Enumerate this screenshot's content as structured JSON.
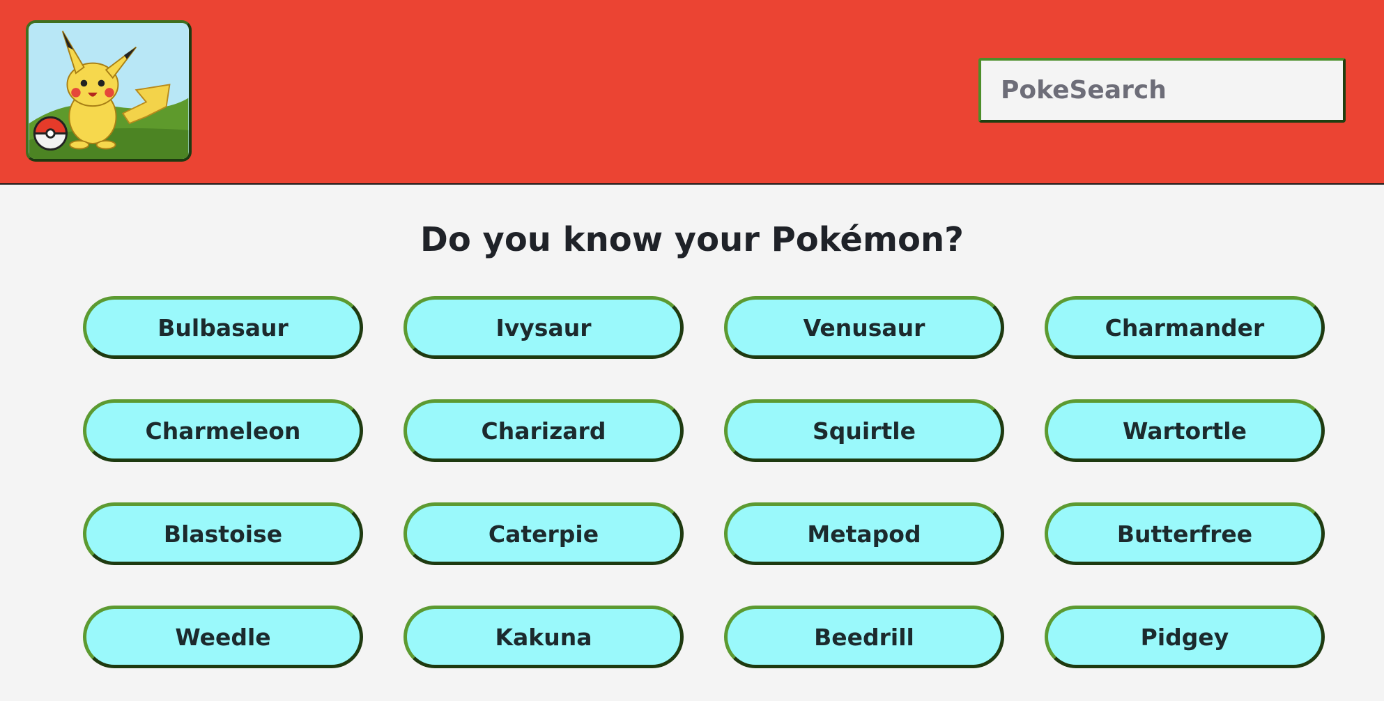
{
  "header": {
    "logo_alt": "Pikachu",
    "search": {
      "placeholder": "PokeSearch",
      "value": ""
    }
  },
  "main": {
    "heading": "Do you know your Pokémon?",
    "pokemon": [
      "Bulbasaur",
      "Ivysaur",
      "Venusaur",
      "Charmander",
      "Charmeleon",
      "Charizard",
      "Squirtle",
      "Wartortle",
      "Blastoise",
      "Caterpie",
      "Metapod",
      "Butterfree",
      "Weedle",
      "Kakuna",
      "Beedrill",
      "Pidgey"
    ]
  },
  "colors": {
    "header_bg": "#eb4433",
    "page_bg": "#f4f4f4",
    "button_bg": "#9af9fb",
    "button_border": "#5c9a31"
  }
}
